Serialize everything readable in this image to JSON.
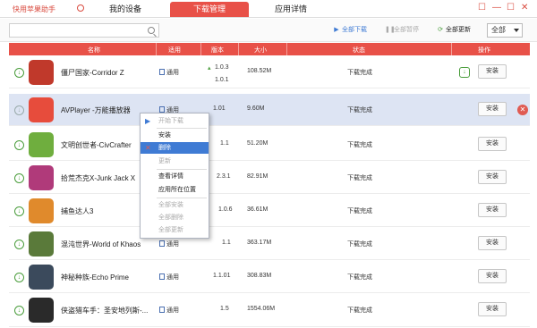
{
  "app": {
    "title": "快用苹果助手",
    "controls": [
      "☐",
      "—",
      "☐",
      "✕"
    ]
  },
  "tabs": [
    {
      "label": "我的设备",
      "active": false
    },
    {
      "label": "下载管理",
      "active": true
    },
    {
      "label": "应用详情",
      "active": false
    }
  ],
  "toolbar": {
    "search_placeholder": "",
    "start_all": "全部下载",
    "pause_all": "全部暂停",
    "update_all": "全部更新",
    "filter_value": "全部"
  },
  "table": {
    "headers": {
      "name": "名称",
      "type": "适用",
      "version": "版本",
      "size": "大小",
      "status": "状态",
      "action": "操作"
    },
    "rows": [
      {
        "name": "僵尸国家-Corridor Z",
        "type": "通用",
        "version": "1.0.3",
        "version2": "1.0.1",
        "size": "108.52M",
        "status": "下载完成",
        "action": "安装",
        "icon_color": "#c0392b",
        "has_update": true
      },
      {
        "name": "AVPlayer -万能播放器",
        "type": "通用",
        "version": "1.01",
        "size": "9.60M",
        "status": "下载完成",
        "action": "安装",
        "icon_color": "#e74c3c",
        "selected": true
      },
      {
        "name": "文明创世者-CivCrafter",
        "type": "通用",
        "version": "1.1",
        "size": "51.20M",
        "status": "下载完成",
        "action": "安装",
        "icon_color": "#6fae3e"
      },
      {
        "name": "拾荒杰克X-Junk Jack X",
        "type": "通用",
        "version": "2.3.1",
        "size": "82.91M",
        "status": "下载完成",
        "action": "安装",
        "icon_color": "#b03a7a"
      },
      {
        "name": "捕鱼达人3",
        "type": "通用",
        "version": "1.0.6",
        "size": "36.61M",
        "status": "下载完成",
        "action": "安装",
        "icon_color": "#e08a2c"
      },
      {
        "name": "混沌世界-World of Khaos",
        "type": "通用",
        "version": "1.1",
        "size": "363.17M",
        "status": "下载完成",
        "action": "安装",
        "icon_color": "#5a7a3a"
      },
      {
        "name": "神秘种族-Echo Prime",
        "type": "通用",
        "version": "1.1.01",
        "size": "308.83M",
        "status": "下载完成",
        "action": "安装",
        "icon_color": "#3b4a5c"
      },
      {
        "name": "侠盗猎车手：圣安地列斯-...",
        "type": "通用",
        "version": "1.5",
        "size": "1554.06M",
        "status": "下载完成",
        "action": "安装",
        "icon_color": "#2a2a2a"
      }
    ]
  },
  "context_menu": {
    "items": [
      {
        "label": "开始下载",
        "disabled": true,
        "icon": "▶"
      },
      {
        "label": "安装",
        "disabled": false,
        "icon": ""
      },
      {
        "label": "删除",
        "disabled": false,
        "highlighted": true,
        "icon": "✕"
      },
      {
        "label": "更新",
        "disabled": true,
        "icon": ""
      },
      {
        "label": "查看详情",
        "disabled": false,
        "icon": ""
      },
      {
        "label": "应用所在位置",
        "disabled": false,
        "icon": ""
      },
      {
        "label": "全部安装",
        "disabled": true,
        "icon": ""
      },
      {
        "label": "全部删除",
        "disabled": true,
        "icon": ""
      },
      {
        "label": "全部更新",
        "disabled": true,
        "icon": ""
      }
    ]
  },
  "colors": {
    "accent": "#e85148",
    "selected_row": "#dde4f3",
    "menu_highlight": "#3f7bd4",
    "ok_green": "#4a9d3c"
  }
}
